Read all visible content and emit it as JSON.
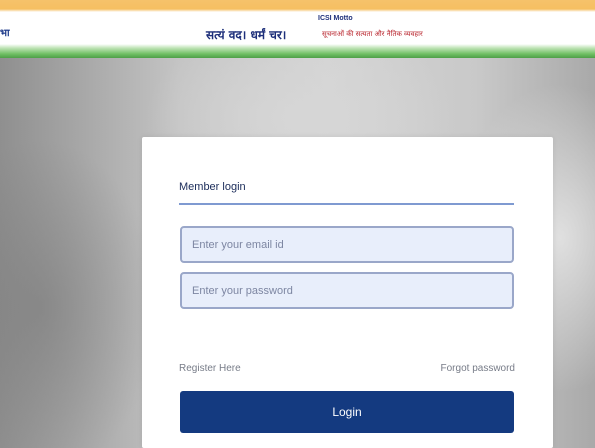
{
  "header": {
    "edge_text": "भा",
    "motto_title": "ICSI Motto",
    "motto_hindi": "सत्यं वद। धर्मं चर।",
    "motto_english": "सूचनाओं की सत्यता और नैतिक व्यवहार"
  },
  "login": {
    "title": "Member login",
    "email_placeholder": "Enter your email id",
    "password_placeholder": "Enter your password",
    "register_link": "Register Here",
    "forgot_link": "Forgot password",
    "login_button": "Login"
  },
  "colors": {
    "saffron": "#f6bf62",
    "green": "#4e9f47",
    "button": "#143a80",
    "input_bg": "#e8eefb"
  }
}
